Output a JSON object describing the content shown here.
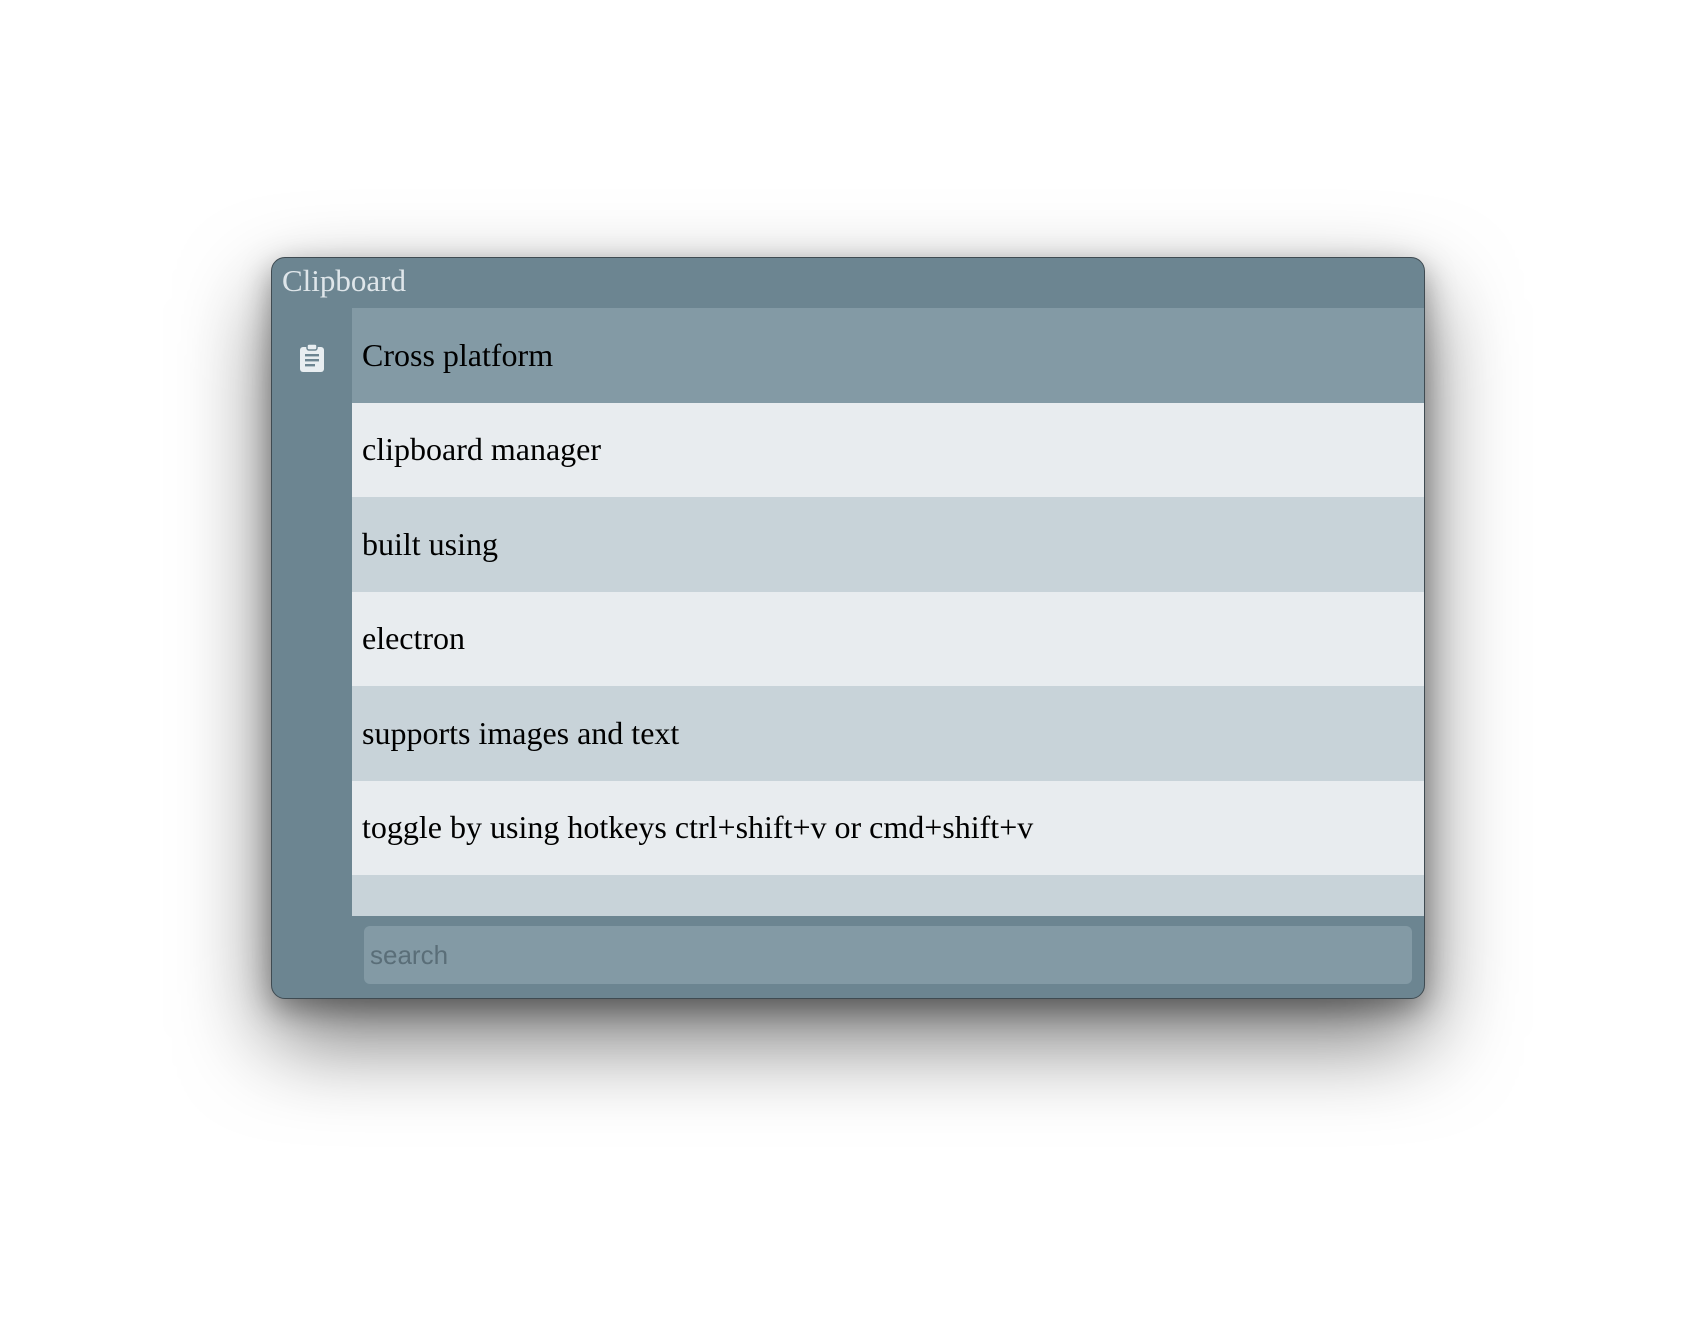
{
  "window": {
    "title": "Clipboard"
  },
  "sidebar": {
    "icon": "clipboard-icon"
  },
  "clips": [
    {
      "text": "Cross platform"
    },
    {
      "text": "clipboard manager"
    },
    {
      "text": "built using"
    },
    {
      "text": "electron"
    },
    {
      "text": "supports images and text"
    },
    {
      "text": "toggle by using hotkeys ctrl+shift+v or cmd+shift+v"
    },
    {
      "text": ""
    }
  ],
  "search": {
    "placeholder": "search",
    "value": ""
  },
  "colors": {
    "window_bg": "#6c8591",
    "selected_row": "#839aa5",
    "row_light": "#e8ecef",
    "row_dark": "#c8d3d9",
    "title_text": "#dfe6ea"
  }
}
